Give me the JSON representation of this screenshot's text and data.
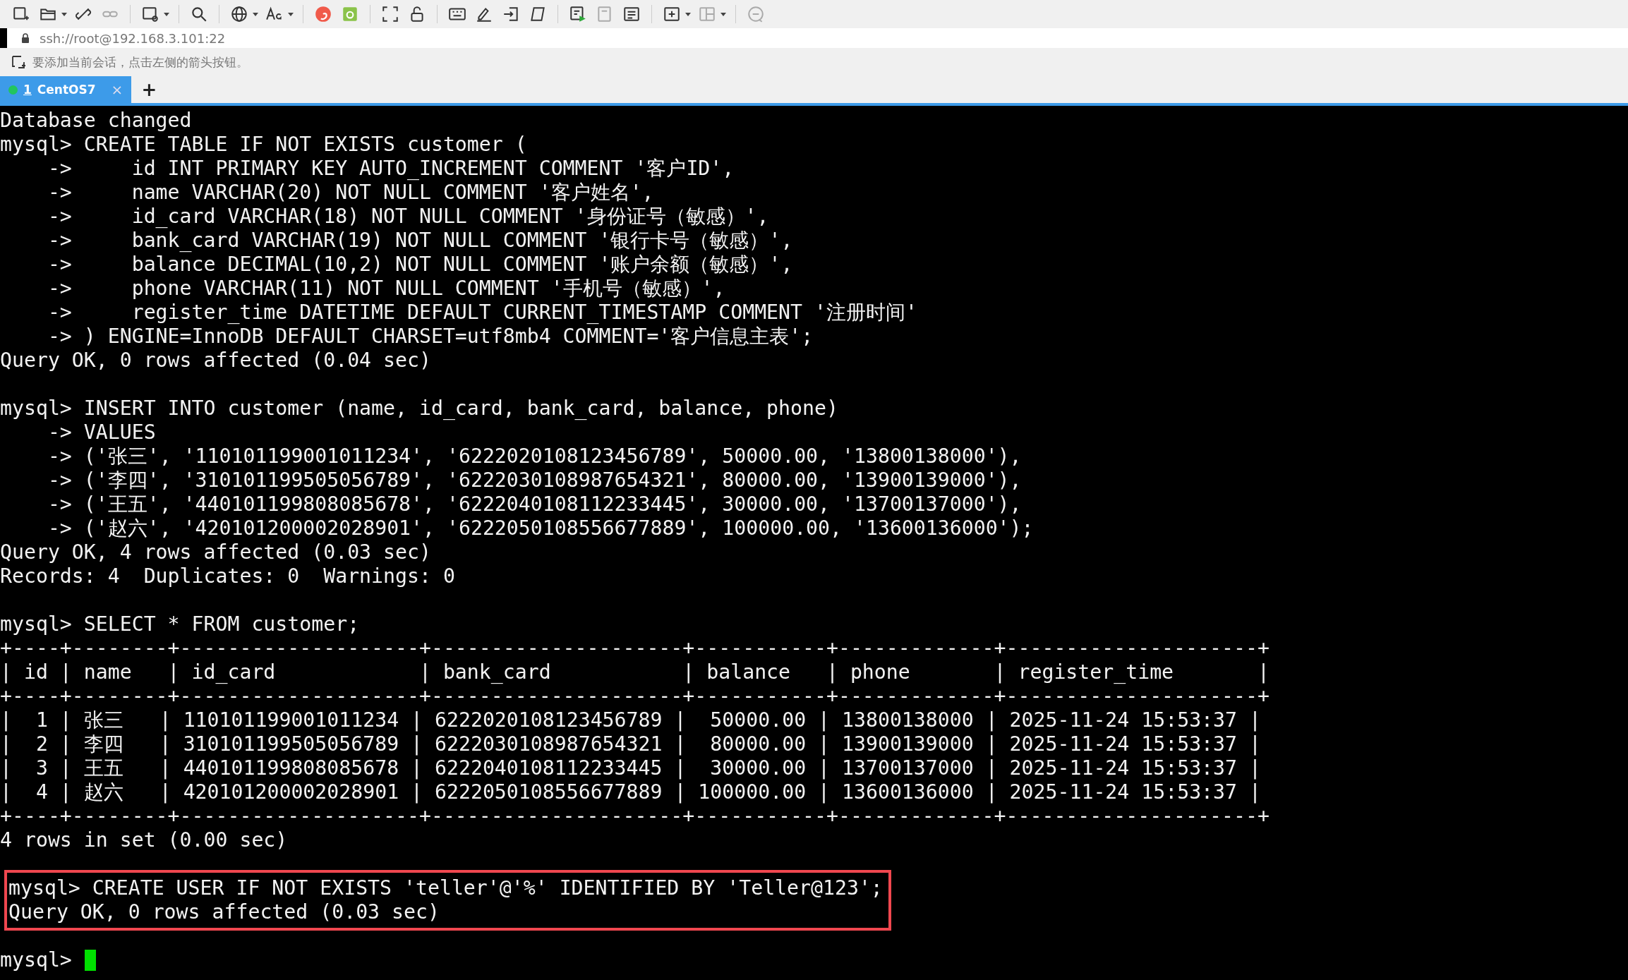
{
  "address_bar": {
    "text": "ssh://root@192.168.3.101:22"
  },
  "hint_bar": {
    "text": "要添加当前会话，点击左侧的箭头按钮。"
  },
  "tabs": [
    {
      "number": "1",
      "label": "CentOS7",
      "selected": true,
      "color": "#22c55e",
      "close": "×"
    }
  ],
  "new_tab": "+",
  "terminal": {
    "blocks": [
      {
        "highlighted": false,
        "lines": [
          "Database changed",
          "mysql> CREATE TABLE IF NOT EXISTS customer (",
          "    ->     id INT PRIMARY KEY AUTO_INCREMENT COMMENT '客户ID',",
          "    ->     name VARCHAR(20) NOT NULL COMMENT '客户姓名',",
          "    ->     id_card VARCHAR(18) NOT NULL COMMENT '身份证号（敏感）',",
          "    ->     bank_card VARCHAR(19) NOT NULL COMMENT '银行卡号（敏感）',",
          "    ->     balance DECIMAL(10,2) NOT NULL COMMENT '账户余额（敏感）',",
          "    ->     phone VARCHAR(11) NOT NULL COMMENT '手机号（敏感）',",
          "    ->     register_time DATETIME DEFAULT CURRENT_TIMESTAMP COMMENT '注册时间'",
          "    -> ) ENGINE=InnoDB DEFAULT CHARSET=utf8mb4 COMMENT='客户信息主表';",
          "Query OK, 0 rows affected (0.04 sec)"
        ]
      },
      {
        "highlighted": false,
        "lines": [
          "mysql> INSERT INTO customer (name, id_card, bank_card, balance, phone)",
          "    -> VALUES",
          "    -> ('张三', '110101199001011234', '6222020108123456789', 50000.00, '13800138000'),",
          "    -> ('李四', '310101199505056789', '6222030108987654321', 80000.00, '13900139000'),",
          "    -> ('王五', '440101199808085678', '6222040108112233445', 30000.00, '13700137000'),",
          "    -> ('赵六', '420101200002028901', '6222050108556677889', 100000.00, '13600136000');",
          "Query OK, 4 rows affected (0.03 sec)",
          "Records: 4  Duplicates: 0  Warnings: 0"
        ]
      },
      {
        "highlighted": false,
        "lines": [
          "mysql> SELECT * FROM customer;",
          "+----+--------+--------------------+---------------------+-----------+-------------+---------------------+",
          "| id | name   | id_card            | bank_card           | balance   | phone       | register_time       |",
          "+----+--------+--------------------+---------------------+-----------+-------------+---------------------+",
          "|  1 | 张三   | 110101199001011234 | 6222020108123456789 |  50000.00 | 13800138000 | 2025-11-24 15:53:37 |",
          "|  2 | 李四   | 310101199505056789 | 6222030108987654321 |  80000.00 | 13900139000 | 2025-11-24 15:53:37 |",
          "|  3 | 王五   | 440101199808085678 | 6222040108112233445 |  30000.00 | 13700137000 | 2025-11-24 15:53:37 |",
          "|  4 | 赵六   | 420101200002028901 | 6222050108556677889 | 100000.00 | 13600136000 | 2025-11-24 15:53:37 |",
          "+----+--------+--------------------+---------------------+-----------+-------------+---------------------+",
          "4 rows in set (0.00 sec)"
        ]
      },
      {
        "highlighted": true,
        "lines": [
          "mysql> CREATE USER IF NOT EXISTS 'teller'@'%' IDENTIFIED BY 'Teller@123';",
          "Query OK, 0 rows affected (0.03 sec)"
        ]
      }
    ],
    "prompt": {
      "text": "mysql>",
      "cursor": true
    }
  }
}
